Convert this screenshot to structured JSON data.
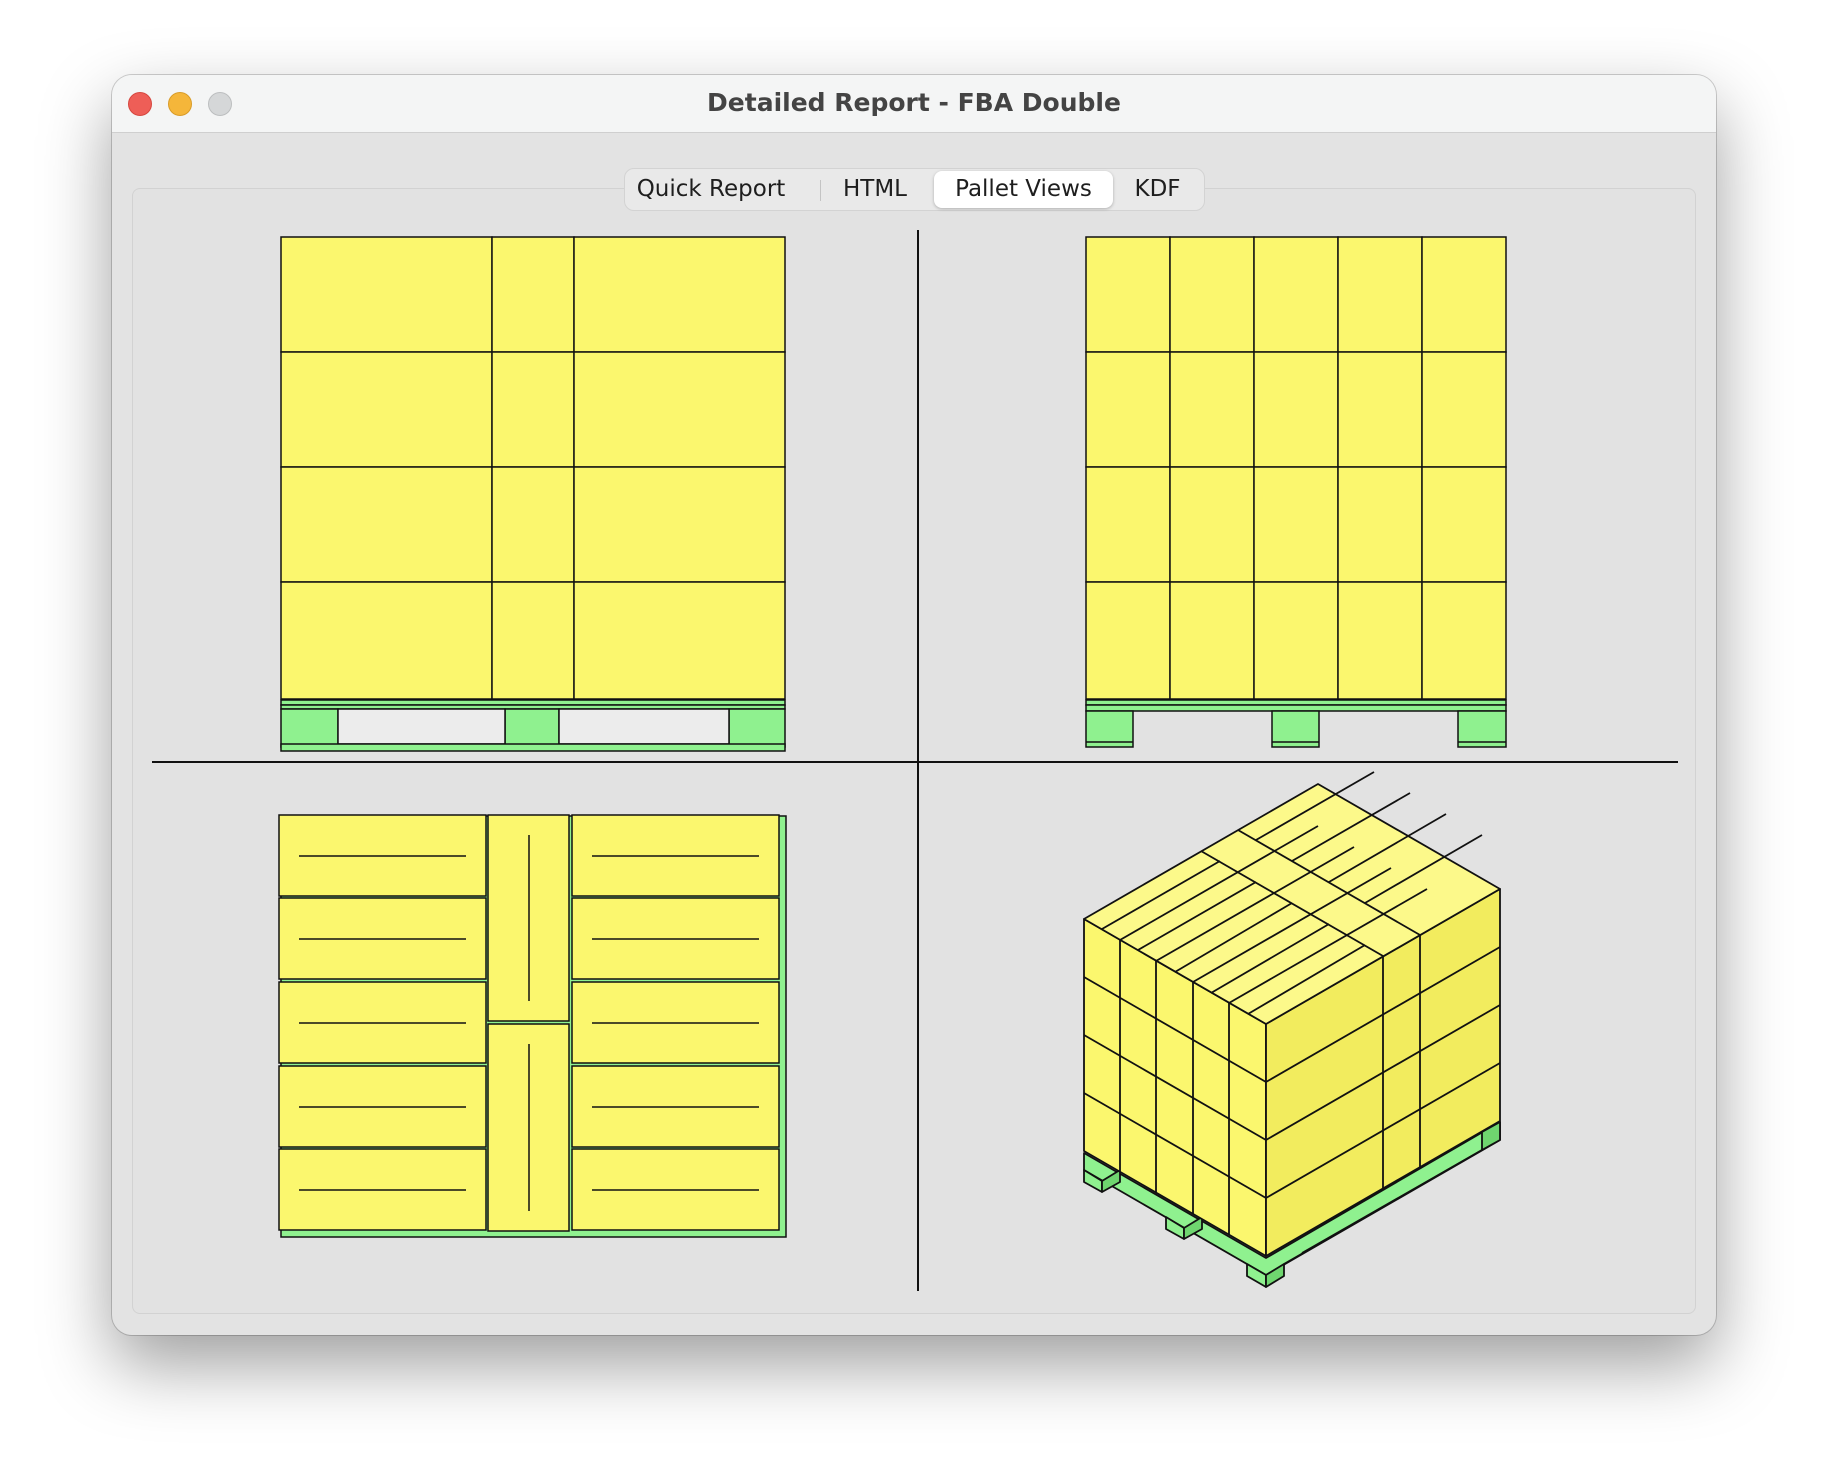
{
  "window": {
    "title": "Detailed Report - FBA Double"
  },
  "tabs": [
    {
      "label": "Quick Report",
      "selected": false
    },
    {
      "label": "HTML",
      "selected": false
    },
    {
      "label": "Pallet Views",
      "selected": true
    },
    {
      "label": "KDF",
      "selected": false
    }
  ],
  "colors": {
    "box": "#fbf76e",
    "box_top": "#fcf98a",
    "box_side": "#ebe457",
    "pallet": "#8ff18f",
    "pallet_dark": "#6fd66f",
    "outline": "#111111"
  },
  "views": {
    "front": {
      "name": "front-view",
      "box_columns": 3,
      "box_rows": 4
    },
    "side": {
      "name": "side-view",
      "box_columns": 5,
      "box_rows": 4
    },
    "top": {
      "name": "top-view",
      "boxes": 12
    },
    "isometric": {
      "name": "isometric-view"
    }
  }
}
